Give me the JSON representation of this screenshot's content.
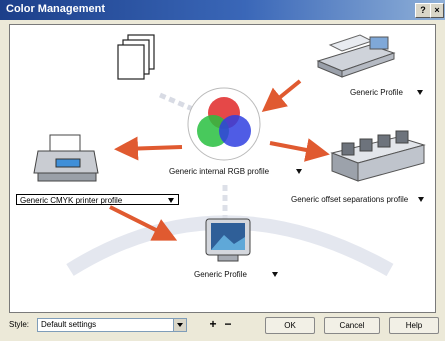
{
  "window": {
    "title": "Color Management",
    "help_glyph": "?",
    "close_glyph": "×"
  },
  "profiles": {
    "top_right": {
      "label": "Generic Profile"
    },
    "center": {
      "label": "Generic internal RGB profile"
    },
    "right": {
      "label": "Generic offset separations profile"
    },
    "left": {
      "label": "Generic CMYK printer profile"
    },
    "bottom": {
      "label": "Generic Profile"
    }
  },
  "footer": {
    "style_label": "Style:",
    "style_value": "Default settings",
    "add_glyph": "+",
    "remove_glyph": "−",
    "ok_label": "OK",
    "cancel_label": "Cancel",
    "help_label": "Help"
  },
  "colors": {
    "arrow": "#e05a30",
    "title_start": "#1c3f8a",
    "title_end": "#8fb0d8"
  }
}
